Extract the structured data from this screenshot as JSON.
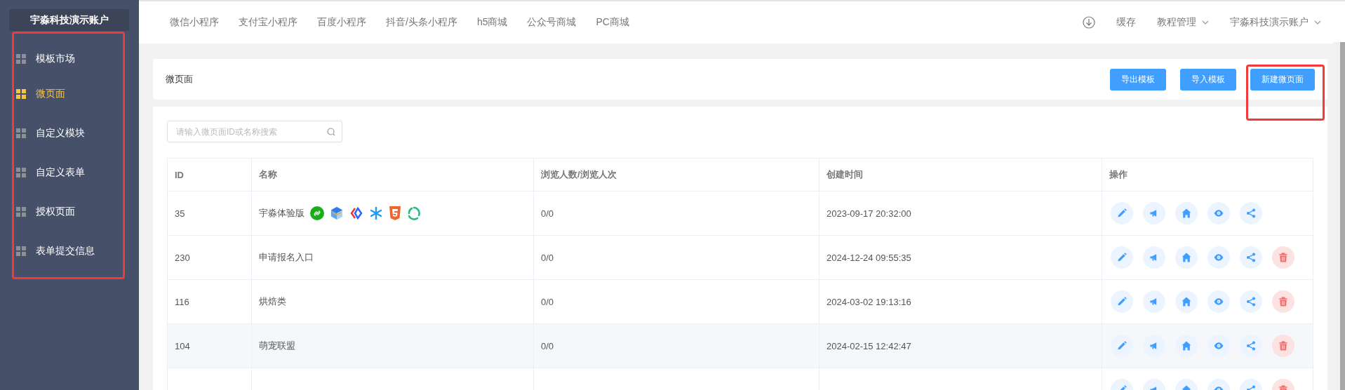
{
  "sidebar": {
    "title": "宇淼科技演示账户",
    "framed": true,
    "items": [
      {
        "label": "模板市场",
        "selected": false
      },
      {
        "label": "微页面",
        "selected": true
      },
      {
        "label": "自定义模块",
        "selected": false
      },
      {
        "label": "自定义表单",
        "selected": false
      },
      {
        "label": "授权页面",
        "selected": false
      },
      {
        "label": "表单提交信息",
        "selected": false
      }
    ]
  },
  "top_nav": {
    "links": [
      "微信小程序",
      "支付宝小程序",
      "百度小程序",
      "抖音/头条小程序",
      "h5商城",
      "公众号商城",
      "PC商城"
    ],
    "cache_label": "缓存",
    "menus": [
      "教程管理",
      "宇淼科技演示账户"
    ]
  },
  "header": {
    "title": "微页面",
    "buttons": [
      {
        "label": "导出模板",
        "framed": false
      },
      {
        "label": "导入模板",
        "framed": false
      },
      {
        "label": "新建微页面",
        "framed": true
      }
    ]
  },
  "search": {
    "placeholder": "请输入微页面ID或名称搜索"
  },
  "table": {
    "columns": [
      "ID",
      "名称",
      "浏览人数/浏览人次",
      "创建时间",
      "操作"
    ],
    "rows": [
      {
        "id": "35",
        "name": "宇淼体验版",
        "platforms": [
          {
            "kind": "link"
          },
          {
            "kind": "cube"
          },
          {
            "kind": "brackets"
          },
          {
            "kind": "asterisk"
          },
          {
            "kind": "html5"
          },
          {
            "kind": "loop"
          }
        ],
        "views": "0/0",
        "created": "2023-09-17 20:32:00",
        "deletable": false,
        "highlighted": false
      },
      {
        "id": "230",
        "name": "申请报名入口",
        "platforms": [],
        "views": "0/0",
        "created": "2024-12-24 09:55:35",
        "deletable": true,
        "highlighted": false
      },
      {
        "id": "116",
        "name": "烘焙类",
        "platforms": [],
        "views": "0/0",
        "created": "2024-03-02 19:13:16",
        "deletable": true,
        "highlighted": false
      },
      {
        "id": "104",
        "name": "萌宠联盟",
        "platforms": [],
        "views": "0/0",
        "created": "2024-02-15 12:42:47",
        "deletable": true,
        "highlighted": true
      },
      {
        "deletable": true,
        "highlighted": false
      }
    ]
  }
}
